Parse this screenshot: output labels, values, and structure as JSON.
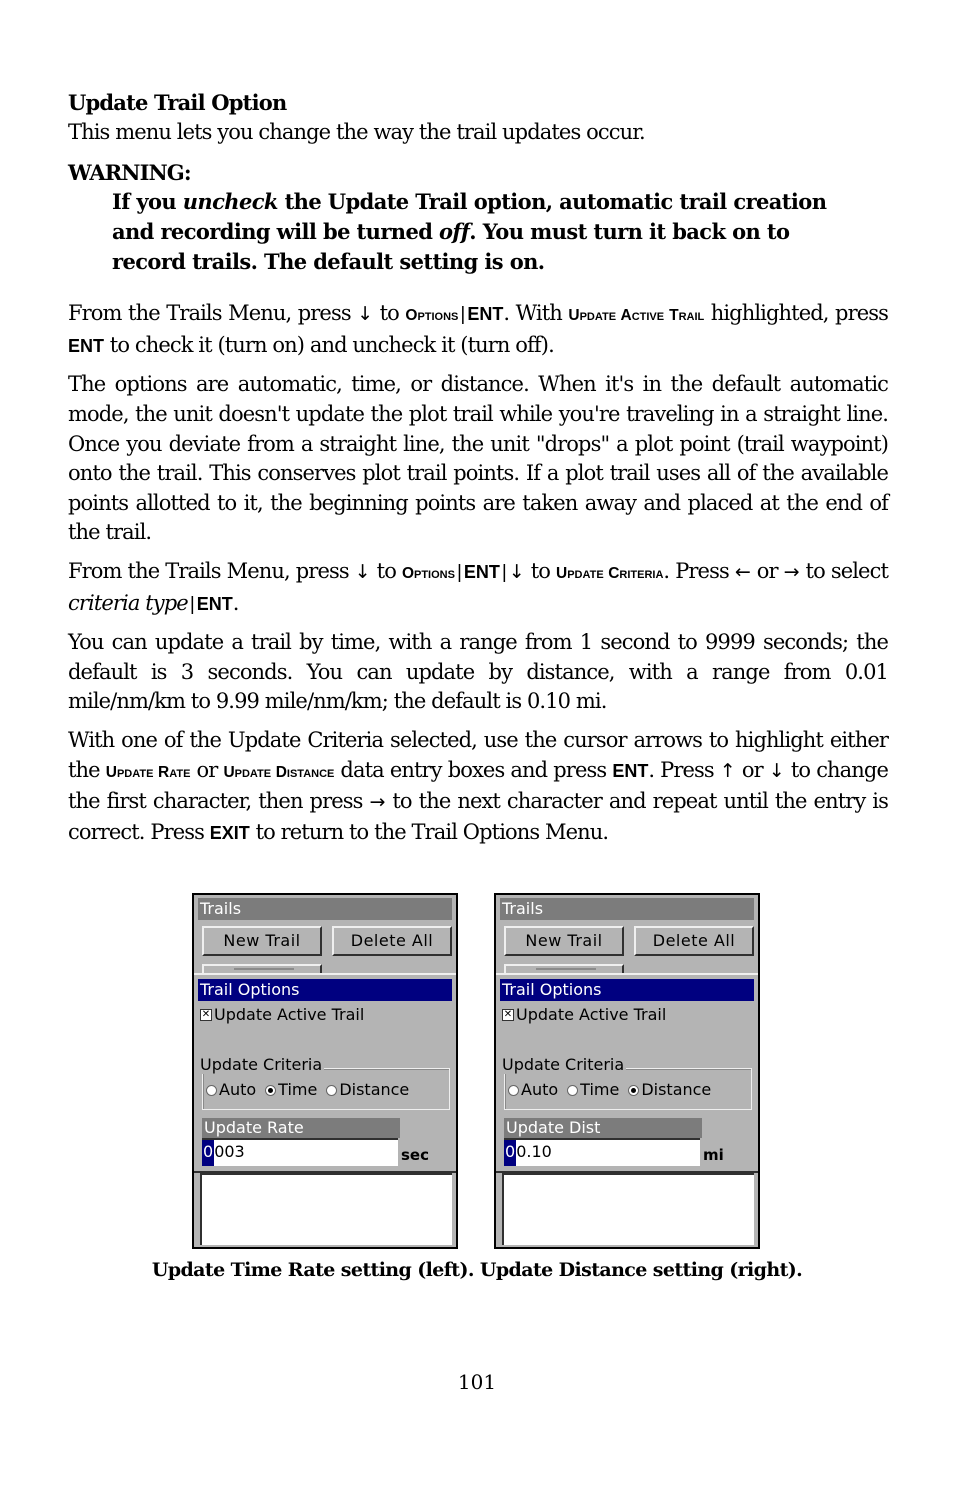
{
  "section": {
    "heading": "Update Trail Option",
    "intro": "This menu lets you change the way the trail updates occur."
  },
  "warning": {
    "label": "WARNING:",
    "part1": "If you ",
    "em1": "uncheck",
    "part2": " the Update Trail option, automatic trail creation and recording will be turned ",
    "em2": "off",
    "part3": ". You must turn it back on to record trails. The default setting is on."
  },
  "para1": {
    "t1": "From the Trails Menu, press ",
    "down": "↓",
    "t2": " to ",
    "k_options": "Options",
    "sep": "|",
    "k_ent": "ENT",
    "t3": ". With ",
    "k_uat": "Update Active Trail",
    "t4": " highlighted, press ",
    "k_ent2": "ENT",
    "t5": " to check it (turn on) and uncheck it (turn off)."
  },
  "para2": {
    "text": "The options are automatic, time, or distance. When it's in the default automatic mode, the unit doesn't update the plot trail while you're traveling in a straight line. Once you deviate from a straight line, the unit \"drops\" a plot point (trail waypoint) onto the trail. This conserves plot trail points. If a plot trail uses all of the available points allotted to it, the beginning points are taken away and placed at the end of the trail."
  },
  "para3": {
    "t1": "From the Trails Menu, press ",
    "down": "↓",
    "t2": " to ",
    "k_options": "Options",
    "sep": "|",
    "k_ent": "ENT",
    "down2": "↓",
    "t3": " to ",
    "k_criteria": "Update Criteria",
    "t4": ". Press ",
    "left": "←",
    "t5": " or ",
    "right": "→",
    "t6": " to select ",
    "em": "criteria type",
    "k_ent2": "ENT",
    "t7": "."
  },
  "para4": {
    "text": "You can update a trail by time, with a range from 1 second to 9999 seconds; the default is 3 seconds. You can update by distance, with a range from 0.01 mile/nm/km to 9.99 mile/nm/km; the default is 0.10 mi."
  },
  "para5": {
    "t1": "With one of the Update Criteria selected, use the cursor arrows to highlight either the ",
    "k_rate": "Update Rate",
    "t2": " or ",
    "k_dist": "Update Distance",
    "t3": " data entry boxes and press ",
    "k_ent": "ENT",
    "t4": ". Press ",
    "up": "↑",
    "t5": " or ",
    "down": "↓",
    "t6": " to change the first character, then press ",
    "right": "→",
    "t7": " to the next character and repeat until the entry is correct. Press ",
    "k_exit": "EXIT",
    "t8": " to return to the Trail Options Menu."
  },
  "screens": [
    {
      "title": "Trails",
      "buttons": [
        "New Trail",
        "Delete All"
      ],
      "options_title": "Trail Options",
      "checkbox_label": "Update Active Trail",
      "checkbox_checked": true,
      "checkbox_mark": "✕",
      "group_label": "Update Criteria",
      "radios": [
        {
          "label": "Auto",
          "selected": false
        },
        {
          "label": "Time",
          "selected": true
        },
        {
          "label": "Distance",
          "selected": false
        }
      ],
      "field_label": "Update Rate",
      "field_cursor_char": "0",
      "field_rest": "003",
      "unit": "sec"
    },
    {
      "title": "Trails",
      "buttons": [
        "New Trail",
        "Delete All"
      ],
      "options_title": "Trail Options",
      "checkbox_label": "Update Active Trail",
      "checkbox_checked": true,
      "checkbox_mark": "✕",
      "group_label": "Update Criteria",
      "radios": [
        {
          "label": "Auto",
          "selected": false
        },
        {
          "label": "Time",
          "selected": false
        },
        {
          "label": "Distance",
          "selected": true
        }
      ],
      "field_label": "Update Dist",
      "field_cursor_char": "0",
      "field_rest": "0.10",
      "unit": "mi"
    }
  ],
  "caption": "Update Time Rate setting (left). Update Distance setting (right).",
  "page_number": "101"
}
